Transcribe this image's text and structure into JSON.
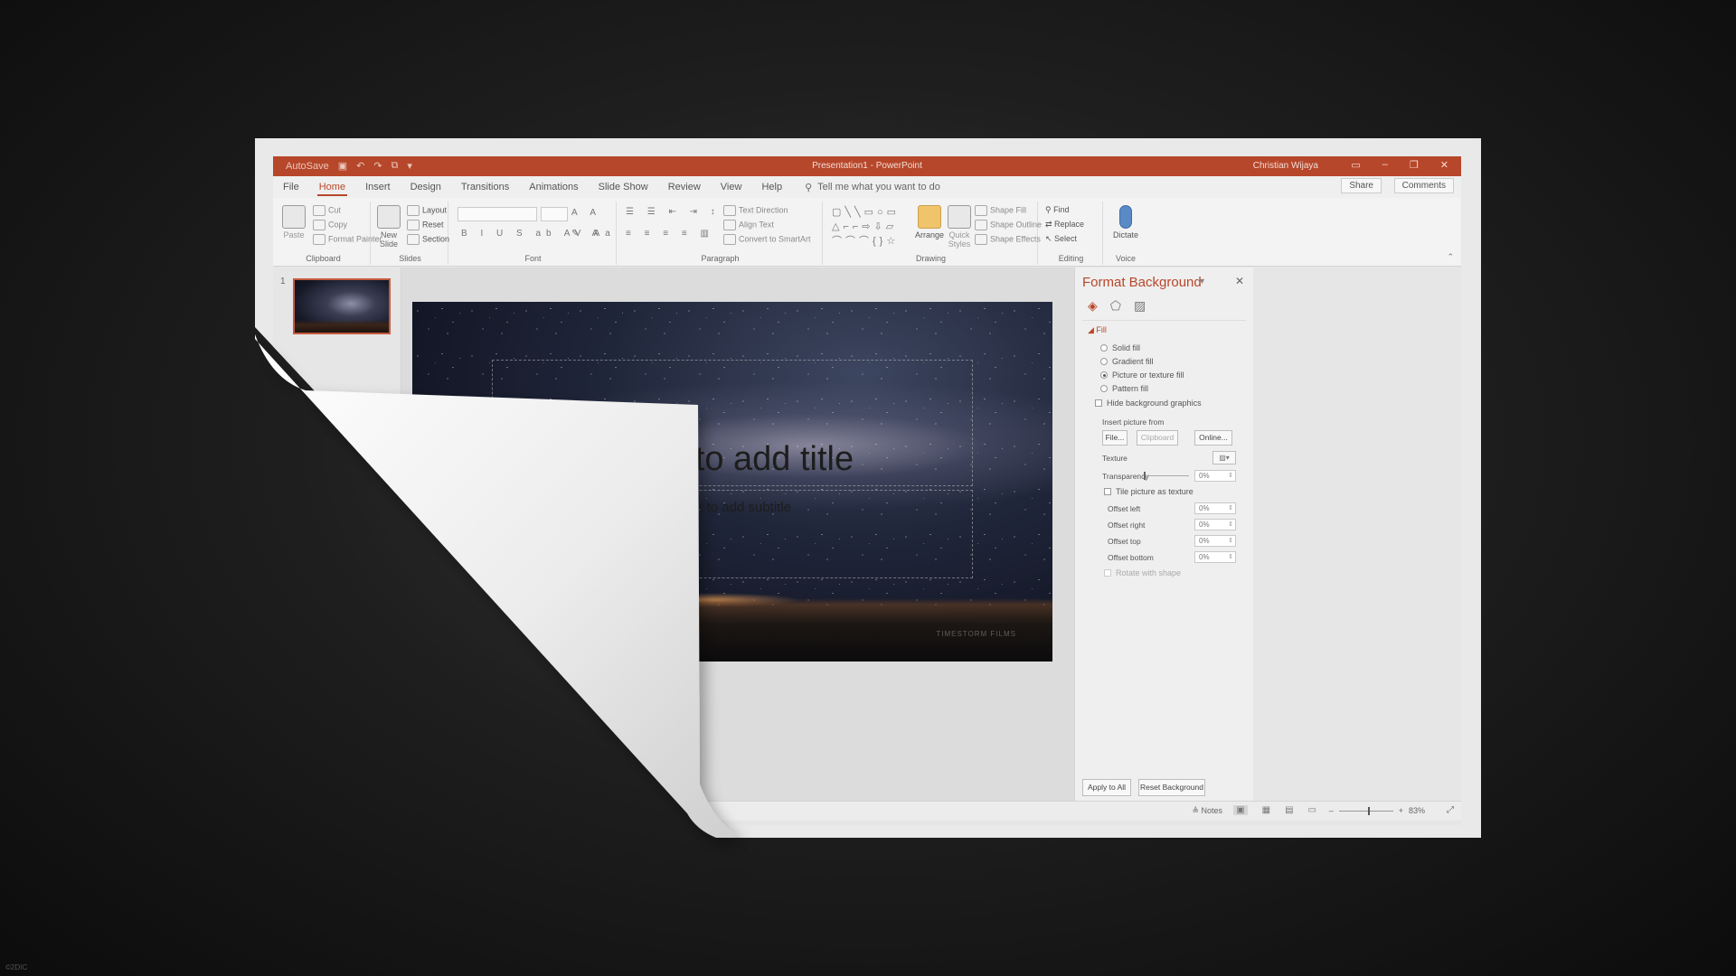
{
  "titlebar": {
    "autosave": "AutoSave",
    "document_title": "Presentation1 - PowerPoint",
    "user": "Christian Wijaya"
  },
  "tabs": [
    "File",
    "Home",
    "Insert",
    "Design",
    "Transitions",
    "Animations",
    "Slide Show",
    "Review",
    "View",
    "Help"
  ],
  "active_tab": "Home",
  "tell_me": "Tell me what you want to do",
  "share": "Share",
  "comments": "Comments",
  "ribbon": {
    "clipboard": {
      "label": "Clipboard",
      "paste": "Paste",
      "cut": "Cut",
      "copy": "Copy",
      "format_painter": "Format Painter"
    },
    "slides": {
      "label": "Slides",
      "new_slide": "New Slide",
      "layout": "Layout",
      "reset": "Reset",
      "section": "Section"
    },
    "font": {
      "label": "Font"
    },
    "paragraph": {
      "label": "Paragraph",
      "text_direction": "Text Direction",
      "align_text": "Align Text",
      "convert": "Convert to SmartArt"
    },
    "drawing": {
      "label": "Drawing",
      "arrange": "Arrange",
      "quick_styles": "Quick Styles",
      "shape_fill": "Shape Fill",
      "shape_outline": "Shape Outline",
      "shape_effects": "Shape Effects"
    },
    "editing": {
      "label": "Editing",
      "find": "Find",
      "replace": "Replace",
      "select": "Select"
    },
    "voice": {
      "label": "Voice",
      "dictate": "Dictate"
    }
  },
  "thumbnail": {
    "number": "1"
  },
  "slide": {
    "title_placeholder": "Click to add title",
    "subtitle_placeholder": "Click to add subtitle",
    "watermark": "TIMESTORM FILMS"
  },
  "format_pane": {
    "title": "Format Background",
    "section": "Fill",
    "options": [
      "Solid fill",
      "Gradient fill",
      "Picture or texture fill",
      "Pattern fill"
    ],
    "selected_option": "Picture or texture fill",
    "hide_bg": "Hide background graphics",
    "insert_from": "Insert picture from",
    "file_btn": "File...",
    "clipboard_btn": "Clipboard",
    "online_btn": "Online...",
    "texture": "Texture",
    "transparency": "Transparency",
    "transparency_value": "0%",
    "tile": "Tile picture as texture",
    "offsets": [
      {
        "label": "Offset left",
        "value": "0%"
      },
      {
        "label": "Offset right",
        "value": "0%"
      },
      {
        "label": "Offset top",
        "value": "0%"
      },
      {
        "label": "Offset bottom",
        "value": "0%"
      }
    ],
    "rotate": "Rotate with shape",
    "apply_all": "Apply to All",
    "reset_bg": "Reset Background"
  },
  "status": {
    "notes": "Notes",
    "zoom": "83%"
  },
  "accent_color": "#b7472a",
  "corner_text": "©2DIC"
}
